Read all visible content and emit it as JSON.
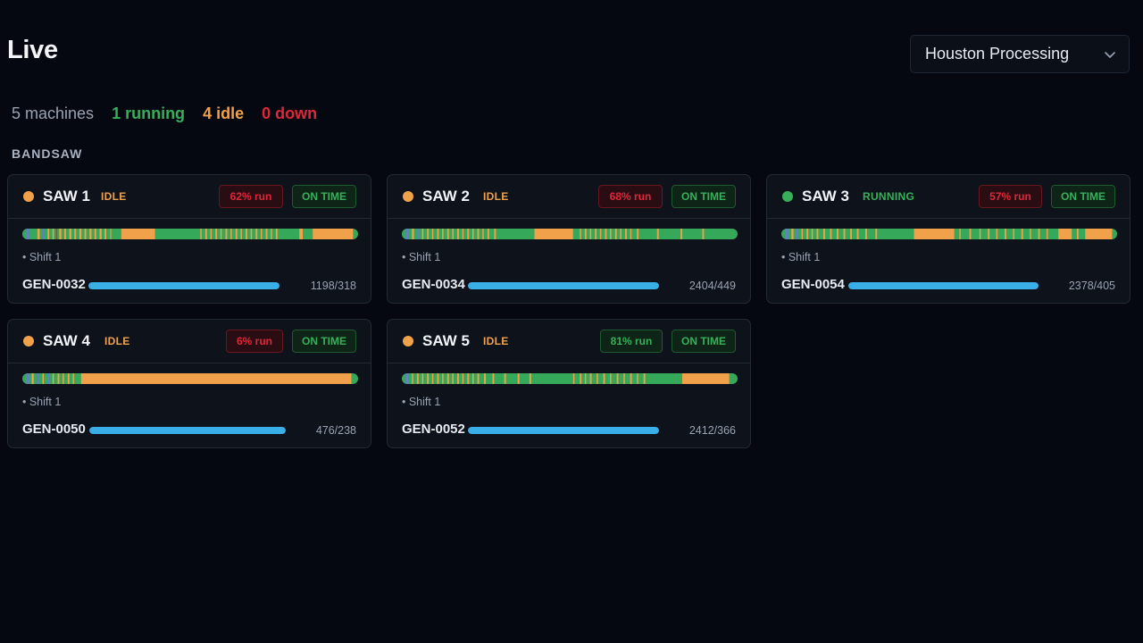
{
  "header": {
    "title": "Live",
    "site_select": {
      "value": "Houston Processing",
      "icon": "chevron-down-icon"
    }
  },
  "summary": {
    "total": "5 machines",
    "running": "1 running",
    "idle": "4 idle",
    "down": "0 down"
  },
  "group": {
    "label": "BANDSAW"
  },
  "colors": {
    "running": "#38b05a",
    "idle": "#f0a14a",
    "down": "#e0263a",
    "progress": "#3aaee6"
  },
  "machines": [
    {
      "name": "SAW 1",
      "state": "IDLE",
      "state_key": "idle",
      "run_badge": "62% run",
      "run_tone": "bad",
      "time_badge": "ON TIME",
      "shift": "• Shift 1",
      "job": "GEN-0032",
      "count": "1198/318",
      "progress": 1.0
    },
    {
      "name": "SAW 2",
      "state": "IDLE",
      "state_key": "idle",
      "run_badge": "68% run",
      "run_tone": "bad",
      "time_badge": "ON TIME",
      "shift": "• Shift 1",
      "job": "GEN-0034",
      "count": "2404/449",
      "progress": 1.0
    },
    {
      "name": "SAW 3",
      "state": "RUNNING",
      "state_key": "running",
      "run_badge": "57% run",
      "run_tone": "bad",
      "time_badge": "ON TIME",
      "shift": "• Shift 1",
      "job": "GEN-0054",
      "count": "2378/405",
      "progress": 1.0
    },
    {
      "name": "SAW 4",
      "state": "IDLE",
      "state_key": "idle",
      "run_badge": "6% run",
      "run_tone": "bad",
      "time_badge": "ON TIME",
      "shift": "• Shift 1",
      "job": "GEN-0050",
      "count": "476/238",
      "progress": 1.0
    },
    {
      "name": "SAW 5",
      "state": "IDLE",
      "state_key": "idle",
      "run_badge": "81% run",
      "run_tone": "good",
      "time_badge": "ON TIME",
      "shift": "• Shift 1",
      "job": "GEN-0052",
      "count": "2412/366",
      "progress": 1.0
    }
  ],
  "timelines": [
    {
      "segments": [
        {
          "from": 0.0,
          "to": 0.012,
          "state": "running"
        },
        {
          "from": 0.012,
          "to": 0.02,
          "state": "other"
        },
        {
          "from": 0.02,
          "to": 0.04,
          "state": "running"
        },
        {
          "from": 0.045,
          "to": 0.052,
          "state": "idle"
        },
        {
          "from": 0.06,
          "to": 0.066,
          "state": "other"
        },
        {
          "from": 0.075,
          "to": 0.08,
          "state": "idle"
        },
        {
          "from": 0.09,
          "to": 0.094,
          "state": "idle"
        },
        {
          "from": 0.1,
          "to": 0.104,
          "state": "down"
        },
        {
          "from": 0.11,
          "to": 0.116,
          "state": "idle"
        },
        {
          "from": 0.125,
          "to": 0.13,
          "state": "idle"
        },
        {
          "from": 0.14,
          "to": 0.146,
          "state": "idle"
        },
        {
          "from": 0.155,
          "to": 0.16,
          "state": "idle"
        },
        {
          "from": 0.17,
          "to": 0.176,
          "state": "idle"
        },
        {
          "from": 0.185,
          "to": 0.19,
          "state": "idle"
        },
        {
          "from": 0.2,
          "to": 0.206,
          "state": "idle"
        },
        {
          "from": 0.215,
          "to": 0.22,
          "state": "idle"
        },
        {
          "from": 0.23,
          "to": 0.236,
          "state": "idle"
        },
        {
          "from": 0.245,
          "to": 0.25,
          "state": "idle"
        },
        {
          "from": 0.262,
          "to": 0.265,
          "state": "idle"
        },
        {
          "from": 0.295,
          "to": 0.395,
          "state": "idle"
        },
        {
          "from": 0.53,
          "to": 0.534,
          "state": "idle"
        },
        {
          "from": 0.545,
          "to": 0.55,
          "state": "idle"
        },
        {
          "from": 0.56,
          "to": 0.564,
          "state": "idle"
        },
        {
          "from": 0.575,
          "to": 0.58,
          "state": "idle"
        },
        {
          "from": 0.59,
          "to": 0.594,
          "state": "idle"
        },
        {
          "from": 0.605,
          "to": 0.61,
          "state": "idle"
        },
        {
          "from": 0.62,
          "to": 0.624,
          "state": "idle"
        },
        {
          "from": 0.635,
          "to": 0.64,
          "state": "idle"
        },
        {
          "from": 0.65,
          "to": 0.654,
          "state": "idle"
        },
        {
          "from": 0.665,
          "to": 0.67,
          "state": "idle"
        },
        {
          "from": 0.68,
          "to": 0.684,
          "state": "idle"
        },
        {
          "from": 0.695,
          "to": 0.7,
          "state": "idle"
        },
        {
          "from": 0.71,
          "to": 0.714,
          "state": "idle"
        },
        {
          "from": 0.725,
          "to": 0.73,
          "state": "idle"
        },
        {
          "from": 0.74,
          "to": 0.744,
          "state": "idle"
        },
        {
          "from": 0.755,
          "to": 0.76,
          "state": "idle"
        },
        {
          "from": 0.825,
          "to": 0.835,
          "state": "idle"
        },
        {
          "from": 0.865,
          "to": 0.985,
          "state": "idle"
        }
      ]
    },
    {
      "segments": [
        {
          "from": 0.0,
          "to": 0.012,
          "state": "running"
        },
        {
          "from": 0.012,
          "to": 0.02,
          "state": "other"
        },
        {
          "from": 0.03,
          "to": 0.036,
          "state": "idle"
        },
        {
          "from": 0.045,
          "to": 0.05,
          "state": "other"
        },
        {
          "from": 0.06,
          "to": 0.064,
          "state": "idle"
        },
        {
          "from": 0.075,
          "to": 0.08,
          "state": "idle"
        },
        {
          "from": 0.09,
          "to": 0.094,
          "state": "idle"
        },
        {
          "from": 0.105,
          "to": 0.11,
          "state": "idle"
        },
        {
          "from": 0.12,
          "to": 0.124,
          "state": "idle"
        },
        {
          "from": 0.135,
          "to": 0.14,
          "state": "idle"
        },
        {
          "from": 0.15,
          "to": 0.154,
          "state": "idle"
        },
        {
          "from": 0.165,
          "to": 0.17,
          "state": "idle"
        },
        {
          "from": 0.18,
          "to": 0.184,
          "state": "idle"
        },
        {
          "from": 0.195,
          "to": 0.2,
          "state": "idle"
        },
        {
          "from": 0.21,
          "to": 0.214,
          "state": "idle"
        },
        {
          "from": 0.225,
          "to": 0.23,
          "state": "idle"
        },
        {
          "from": 0.24,
          "to": 0.244,
          "state": "idle"
        },
        {
          "from": 0.255,
          "to": 0.26,
          "state": "idle"
        },
        {
          "from": 0.275,
          "to": 0.28,
          "state": "idle"
        },
        {
          "from": 0.395,
          "to": 0.51,
          "state": "idle"
        },
        {
          "from": 0.53,
          "to": 0.534,
          "state": "idle"
        },
        {
          "from": 0.545,
          "to": 0.55,
          "state": "idle"
        },
        {
          "from": 0.56,
          "to": 0.564,
          "state": "idle"
        },
        {
          "from": 0.575,
          "to": 0.58,
          "state": "idle"
        },
        {
          "from": 0.59,
          "to": 0.594,
          "state": "idle"
        },
        {
          "from": 0.605,
          "to": 0.61,
          "state": "idle"
        },
        {
          "from": 0.62,
          "to": 0.624,
          "state": "idle"
        },
        {
          "from": 0.635,
          "to": 0.64,
          "state": "idle"
        },
        {
          "from": 0.65,
          "to": 0.654,
          "state": "idle"
        },
        {
          "from": 0.665,
          "to": 0.67,
          "state": "idle"
        },
        {
          "from": 0.68,
          "to": 0.684,
          "state": "idle"
        },
        {
          "from": 0.7,
          "to": 0.705,
          "state": "idle"
        },
        {
          "from": 0.76,
          "to": 0.765,
          "state": "idle"
        },
        {
          "from": 0.83,
          "to": 0.835,
          "state": "idle"
        },
        {
          "from": 0.895,
          "to": 0.9,
          "state": "idle"
        }
      ]
    },
    {
      "segments": [
        {
          "from": 0.012,
          "to": 0.02,
          "state": "other"
        },
        {
          "from": 0.03,
          "to": 0.036,
          "state": "idle"
        },
        {
          "from": 0.045,
          "to": 0.05,
          "state": "other"
        },
        {
          "from": 0.06,
          "to": 0.064,
          "state": "idle"
        },
        {
          "from": 0.075,
          "to": 0.08,
          "state": "idle"
        },
        {
          "from": 0.09,
          "to": 0.094,
          "state": "idle"
        },
        {
          "from": 0.105,
          "to": 0.11,
          "state": "idle"
        },
        {
          "from": 0.125,
          "to": 0.13,
          "state": "idle"
        },
        {
          "from": 0.145,
          "to": 0.15,
          "state": "idle"
        },
        {
          "from": 0.165,
          "to": 0.17,
          "state": "idle"
        },
        {
          "from": 0.185,
          "to": 0.19,
          "state": "idle"
        },
        {
          "from": 0.205,
          "to": 0.21,
          "state": "idle"
        },
        {
          "from": 0.225,
          "to": 0.23,
          "state": "idle"
        },
        {
          "from": 0.25,
          "to": 0.255,
          "state": "idle"
        },
        {
          "from": 0.28,
          "to": 0.285,
          "state": "idle"
        },
        {
          "from": 0.395,
          "to": 0.515,
          "state": "idle"
        },
        {
          "from": 0.53,
          "to": 0.534,
          "state": "idle"
        },
        {
          "from": 0.56,
          "to": 0.565,
          "state": "idle"
        },
        {
          "from": 0.59,
          "to": 0.594,
          "state": "idle"
        },
        {
          "from": 0.615,
          "to": 0.62,
          "state": "idle"
        },
        {
          "from": 0.64,
          "to": 0.644,
          "state": "idle"
        },
        {
          "from": 0.665,
          "to": 0.67,
          "state": "idle"
        },
        {
          "from": 0.69,
          "to": 0.694,
          "state": "idle"
        },
        {
          "from": 0.715,
          "to": 0.72,
          "state": "idle"
        },
        {
          "from": 0.74,
          "to": 0.744,
          "state": "idle"
        },
        {
          "from": 0.765,
          "to": 0.77,
          "state": "idle"
        },
        {
          "from": 0.79,
          "to": 0.794,
          "state": "idle"
        },
        {
          "from": 0.825,
          "to": 0.865,
          "state": "idle"
        },
        {
          "from": 0.88,
          "to": 0.885,
          "state": "idle"
        },
        {
          "from": 0.905,
          "to": 0.985,
          "state": "idle"
        }
      ]
    },
    {
      "segments": [
        {
          "from": 0.012,
          "to": 0.02,
          "state": "other"
        },
        {
          "from": 0.028,
          "to": 0.034,
          "state": "idle"
        },
        {
          "from": 0.045,
          "to": 0.05,
          "state": "other"
        },
        {
          "from": 0.06,
          "to": 0.064,
          "state": "idle"
        },
        {
          "from": 0.075,
          "to": 0.08,
          "state": "other"
        },
        {
          "from": 0.09,
          "to": 0.094,
          "state": "idle"
        },
        {
          "from": 0.105,
          "to": 0.11,
          "state": "idle"
        },
        {
          "from": 0.12,
          "to": 0.124,
          "state": "idle"
        },
        {
          "from": 0.135,
          "to": 0.14,
          "state": "idle"
        },
        {
          "from": 0.15,
          "to": 0.154,
          "state": "idle"
        },
        {
          "from": 0.175,
          "to": 0.98,
          "state": "idle"
        }
      ]
    },
    {
      "segments": [
        {
          "from": 0.012,
          "to": 0.02,
          "state": "other"
        },
        {
          "from": 0.03,
          "to": 0.034,
          "state": "idle"
        },
        {
          "from": 0.045,
          "to": 0.05,
          "state": "idle"
        },
        {
          "from": 0.06,
          "to": 0.064,
          "state": "idle"
        },
        {
          "from": 0.075,
          "to": 0.08,
          "state": "idle"
        },
        {
          "from": 0.09,
          "to": 0.094,
          "state": "idle"
        },
        {
          "from": 0.105,
          "to": 0.11,
          "state": "idle"
        },
        {
          "from": 0.12,
          "to": 0.124,
          "state": "idle"
        },
        {
          "from": 0.135,
          "to": 0.14,
          "state": "idle"
        },
        {
          "from": 0.15,
          "to": 0.154,
          "state": "idle"
        },
        {
          "from": 0.165,
          "to": 0.17,
          "state": "idle"
        },
        {
          "from": 0.18,
          "to": 0.184,
          "state": "idle"
        },
        {
          "from": 0.195,
          "to": 0.2,
          "state": "idle"
        },
        {
          "from": 0.21,
          "to": 0.214,
          "state": "idle"
        },
        {
          "from": 0.225,
          "to": 0.23,
          "state": "idle"
        },
        {
          "from": 0.245,
          "to": 0.25,
          "state": "idle"
        },
        {
          "from": 0.27,
          "to": 0.275,
          "state": "idle"
        },
        {
          "from": 0.305,
          "to": 0.31,
          "state": "idle"
        },
        {
          "from": 0.345,
          "to": 0.35,
          "state": "idle"
        },
        {
          "from": 0.38,
          "to": 0.385,
          "state": "idle"
        },
        {
          "from": 0.51,
          "to": 0.514,
          "state": "idle"
        },
        {
          "from": 0.53,
          "to": 0.535,
          "state": "idle"
        },
        {
          "from": 0.545,
          "to": 0.549,
          "state": "idle"
        },
        {
          "from": 0.56,
          "to": 0.565,
          "state": "idle"
        },
        {
          "from": 0.58,
          "to": 0.584,
          "state": "idle"
        },
        {
          "from": 0.6,
          "to": 0.605,
          "state": "idle"
        },
        {
          "from": 0.62,
          "to": 0.624,
          "state": "idle"
        },
        {
          "from": 0.64,
          "to": 0.645,
          "state": "idle"
        },
        {
          "from": 0.66,
          "to": 0.664,
          "state": "idle"
        },
        {
          "from": 0.68,
          "to": 0.685,
          "state": "idle"
        },
        {
          "from": 0.7,
          "to": 0.704,
          "state": "idle"
        },
        {
          "from": 0.72,
          "to": 0.725,
          "state": "idle"
        },
        {
          "from": 0.835,
          "to": 0.975,
          "state": "idle"
        }
      ]
    }
  ]
}
